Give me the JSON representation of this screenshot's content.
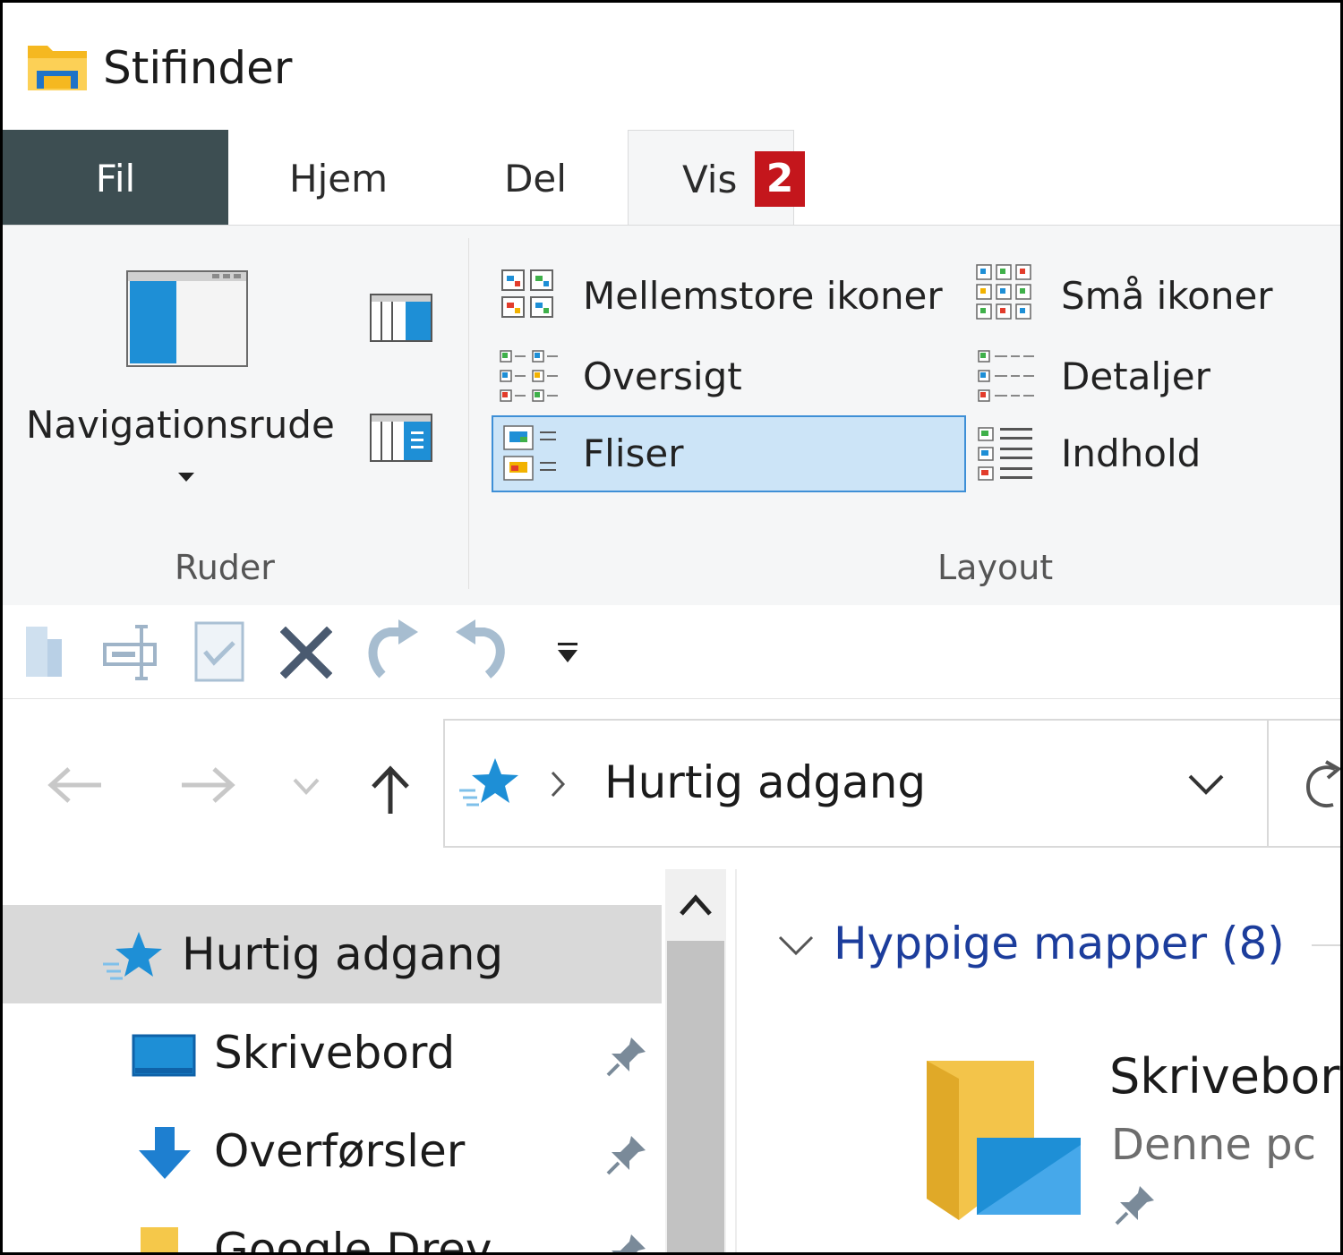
{
  "window": {
    "title": "Stifinder"
  },
  "tabs": [
    {
      "label": "Fil"
    },
    {
      "label": "Hjem"
    },
    {
      "label": "Del"
    },
    {
      "label": "Vis"
    }
  ],
  "step_badge": "2",
  "ribbon": {
    "panes_group": {
      "label": "Ruder",
      "navigation_pane_label": "Navigationsrude"
    },
    "layout_group": {
      "label": "Layout",
      "items": [
        {
          "label": "Mellemstore ikoner"
        },
        {
          "label": "Små ikoner"
        },
        {
          "label": "Oversigt"
        },
        {
          "label": "Detaljer"
        },
        {
          "label": "Fliser",
          "selected": true
        },
        {
          "label": "Indhold"
        }
      ]
    }
  },
  "address": {
    "location": "Hurtig adgang"
  },
  "nav_tree": {
    "items": [
      {
        "label": "Hurtig adgang",
        "icon": "star-icon",
        "selected": true
      },
      {
        "label": "Skrivebord",
        "icon": "desktop-icon",
        "pinned": true
      },
      {
        "label": "Overførsler",
        "icon": "download-icon",
        "pinned": true
      },
      {
        "label": "Google Drev",
        "icon": "folder-icon",
        "pinned": true
      }
    ]
  },
  "content": {
    "section_title": "Hyppige mapper (8)",
    "tile": {
      "name": "Skrivebord",
      "location": "Denne pc"
    }
  },
  "colors": {
    "file_tab": "#3d4e52",
    "badge": "#c4161c",
    "accent_blue": "#1e8fd6",
    "selection": "#cce4f7",
    "section_title": "#1c3d9c"
  }
}
